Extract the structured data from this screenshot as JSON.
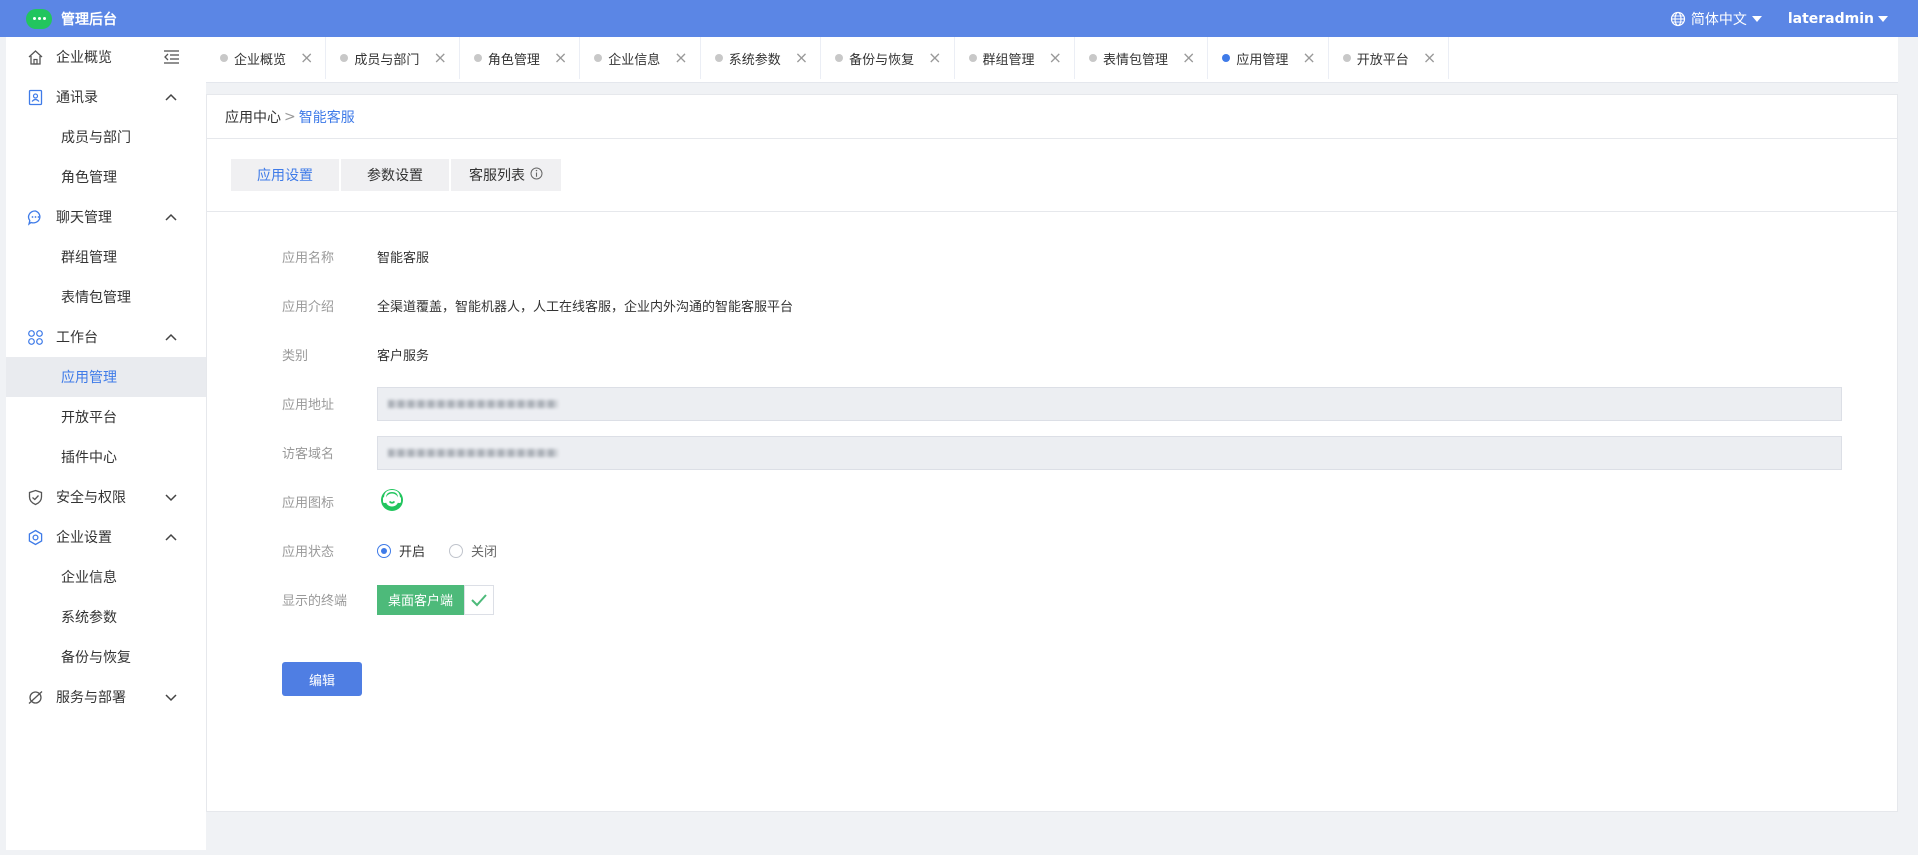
{
  "header": {
    "title": "管理后台",
    "language": "简体中文",
    "username": "lateradmin"
  },
  "sidebar": {
    "items": [
      {
        "type": "group",
        "label": "企业概览",
        "icon": "home-icon"
      },
      {
        "type": "group",
        "label": "通讯录",
        "icon": "contacts-icon",
        "expanded": true
      },
      {
        "type": "sub",
        "label": "成员与部门"
      },
      {
        "type": "sub",
        "label": "角色管理"
      },
      {
        "type": "group",
        "label": "聊天管理",
        "icon": "chat-icon",
        "expanded": true
      },
      {
        "type": "sub",
        "label": "群组管理"
      },
      {
        "type": "sub",
        "label": "表情包管理"
      },
      {
        "type": "group",
        "label": "工作台",
        "icon": "workbench-icon",
        "expanded": true
      },
      {
        "type": "sub",
        "label": "应用管理",
        "active": true
      },
      {
        "type": "sub",
        "label": "开放平台"
      },
      {
        "type": "sub",
        "label": "插件中心"
      },
      {
        "type": "group",
        "label": "安全与权限",
        "icon": "shield-icon",
        "expanded": false
      },
      {
        "type": "group",
        "label": "企业设置",
        "icon": "settings-icon",
        "expanded": true
      },
      {
        "type": "sub",
        "label": "企业信息"
      },
      {
        "type": "sub",
        "label": "系统参数"
      },
      {
        "type": "sub",
        "label": "备份与恢复"
      },
      {
        "type": "group",
        "label": "服务与部署",
        "icon": "planet-icon",
        "expanded": false
      }
    ]
  },
  "tabs": [
    {
      "label": "企业概览"
    },
    {
      "label": "成员与部门"
    },
    {
      "label": "角色管理"
    },
    {
      "label": "企业信息"
    },
    {
      "label": "系统参数"
    },
    {
      "label": "备份与恢复"
    },
    {
      "label": "群组管理"
    },
    {
      "label": "表情包管理"
    },
    {
      "label": "应用管理",
      "active": true
    },
    {
      "label": "开放平台"
    }
  ],
  "breadcrumb": {
    "parent": "应用中心",
    "separator": ">",
    "current": "智能客服"
  },
  "subtabs": {
    "app_settings": "应用设置",
    "param_settings": "参数设置",
    "agent_list": "客服列表"
  },
  "form": {
    "name_label": "应用名称",
    "name_value": "智能客服",
    "intro_label": "应用介绍",
    "intro_value": "全渠道覆盖，智能机器人，人工在线客服，企业内外沟通的智能客服平台",
    "category_label": "类别",
    "category_value": "客户服务",
    "address_label": "应用地址",
    "domain_label": "访客域名",
    "icon_label": "应用图标",
    "status_label": "应用状态",
    "status_on": "开启",
    "status_off": "关闭",
    "terminal_label": "显示的终端",
    "terminal_value": "桌面客户端",
    "edit_button": "编辑"
  },
  "colors": {
    "header": "#5b86e5",
    "accent": "#3f7be8",
    "terminal": "#4dba7a",
    "logo": "#22c55e"
  }
}
